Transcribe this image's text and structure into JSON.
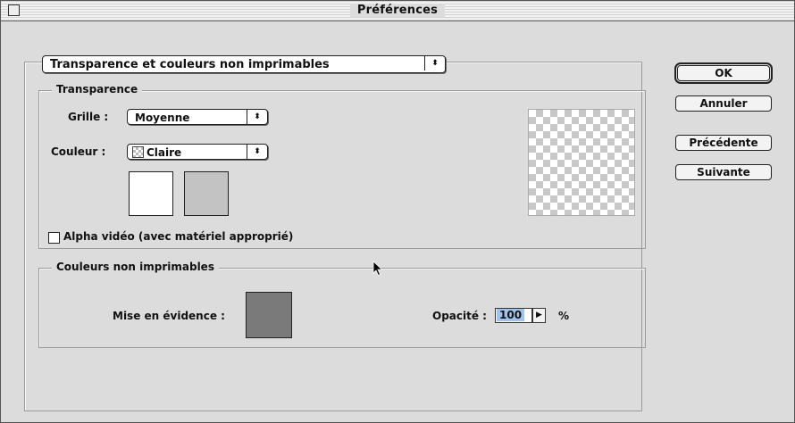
{
  "window": {
    "title": "Préférences"
  },
  "section_select": {
    "value": "Transparence et couleurs non imprimables"
  },
  "transparence": {
    "title": "Transparence",
    "grille_label": "Grille :",
    "grille_value": "Moyenne",
    "couleur_label": "Couleur :",
    "couleur_value": "Claire",
    "swatch_1_color": "#ffffff",
    "swatch_2_color": "#c3c3c3",
    "alpha_label": "Alpha vidéo (avec matériel approprié)",
    "alpha_checked": false
  },
  "non_imprimables": {
    "title": "Couleurs non imprimables",
    "mise_label": "Mise en évidence :",
    "mise_color": "#7a7a7a",
    "opacite_label": "Opacité :",
    "opacite_value": "100",
    "opacite_unit": "%"
  },
  "buttons": {
    "ok": "OK",
    "annuler": "Annuler",
    "precedente": "Précédente",
    "suivante": "Suivante"
  }
}
